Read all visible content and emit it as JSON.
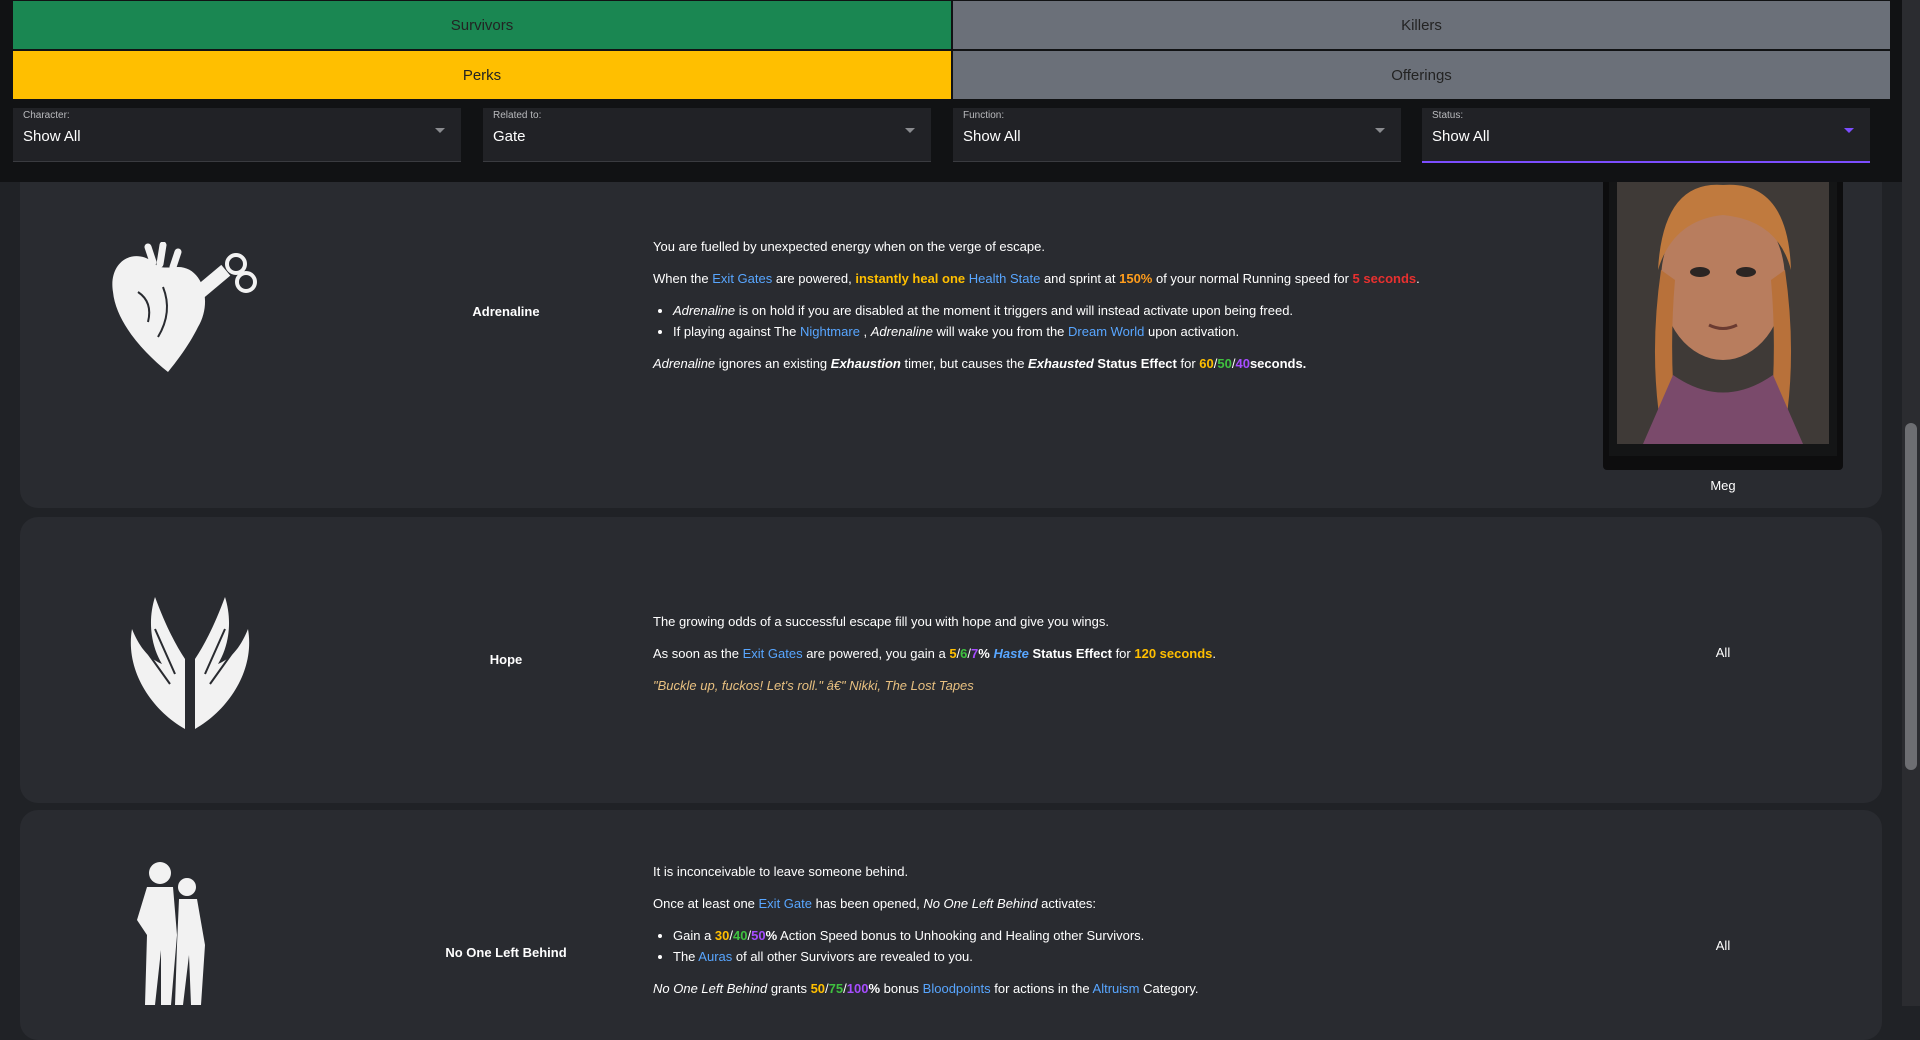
{
  "nav": {
    "survivors": "Survivors",
    "killers": "Killers",
    "perks": "Perks",
    "offerings": "Offerings"
  },
  "filters": {
    "character": {
      "label": "Character:",
      "value": "Show All"
    },
    "related": {
      "label": "Related to:",
      "value": "Gate"
    },
    "function": {
      "label": "Function:",
      "value": "Show All"
    },
    "status": {
      "label": "Status:",
      "value": "Show All"
    }
  },
  "perks": [
    {
      "name": "Adrenaline",
      "character": "Meg",
      "icon": "adrenaline-heart-icon",
      "intro": "You are fuelled by unexpected energy when on the verge of escape.",
      "p2": {
        "a": "When the ",
        "link1": "Exit Gates",
        "b": " are powered, ",
        "gold": "instantly heal one",
        "c": " ",
        "link2": "Health State",
        "d": " and sprint at ",
        "orange": "150%",
        "e": " of your normal Running speed for ",
        "red": "5 seconds",
        "f": "."
      },
      "li1": {
        "it": "Adrenaline",
        "rest": " is on hold if you are disabled at the moment it triggers and will instead activate upon being freed."
      },
      "li2": {
        "a": "If playing against The ",
        "link1": "Nightmare",
        "b": " , ",
        "it": "Adrenaline",
        "c": " will wake you from the ",
        "link2": "Dream World",
        "d": " upon activation."
      },
      "p3": {
        "it": "Adrenaline",
        "a": " ignores an existing ",
        "bi1": "Exhaustion",
        "b": " timer, but causes the ",
        "bi2": "Exhausted",
        "c": " Status Effect",
        "d": " for ",
        "v1": "60",
        "v2": "50",
        "v3": "40",
        "e": "seconds."
      }
    },
    {
      "name": "Hope",
      "character": "All",
      "icon": "hope-wings-icon",
      "intro": "The growing odds of a successful escape fill you with hope and give you wings.",
      "p2": {
        "a": "As soon as the ",
        "link1": "Exit Gates",
        "b": " are powered, you gain a ",
        "v1": "5",
        "v2": "6",
        "v3": "7",
        "pct": "%",
        "blue": "Haste",
        "c": " Status Effect",
        "d": " for ",
        "gold": "120 seconds",
        "e": "."
      },
      "quote": "\"Buckle up, fuckos! Let's roll.\" â€\" Nikki, The Lost Tapes"
    },
    {
      "name": "No One Left Behind",
      "character": "All",
      "icon": "no-one-left-behind-icon",
      "intro": "It is inconceivable to leave someone behind.",
      "p2": {
        "a": "Once at least one ",
        "link1": "Exit Gate",
        "b": " has been opened, ",
        "it": "No One Left Behind",
        "c": " activates:"
      },
      "li1": {
        "a": "Gain a ",
        "v1": "30",
        "v2": "40",
        "v3": "50",
        "pct": "%",
        "b": " Action Speed bonus to Unhooking and Healing other Survivors."
      },
      "li2": {
        "a": "The ",
        "link1": "Auras",
        "b": " of all other Survivors are revealed to you."
      },
      "p3": {
        "it": "No One Left Behind",
        "a": " grants ",
        "v1": "50",
        "v2": "75",
        "v3": "100",
        "pct": "%",
        "b": " bonus ",
        "link1": "Bloodpoints",
        "c": " for actions in the ",
        "link2": "Altruism",
        "d": " Category."
      }
    }
  ]
}
